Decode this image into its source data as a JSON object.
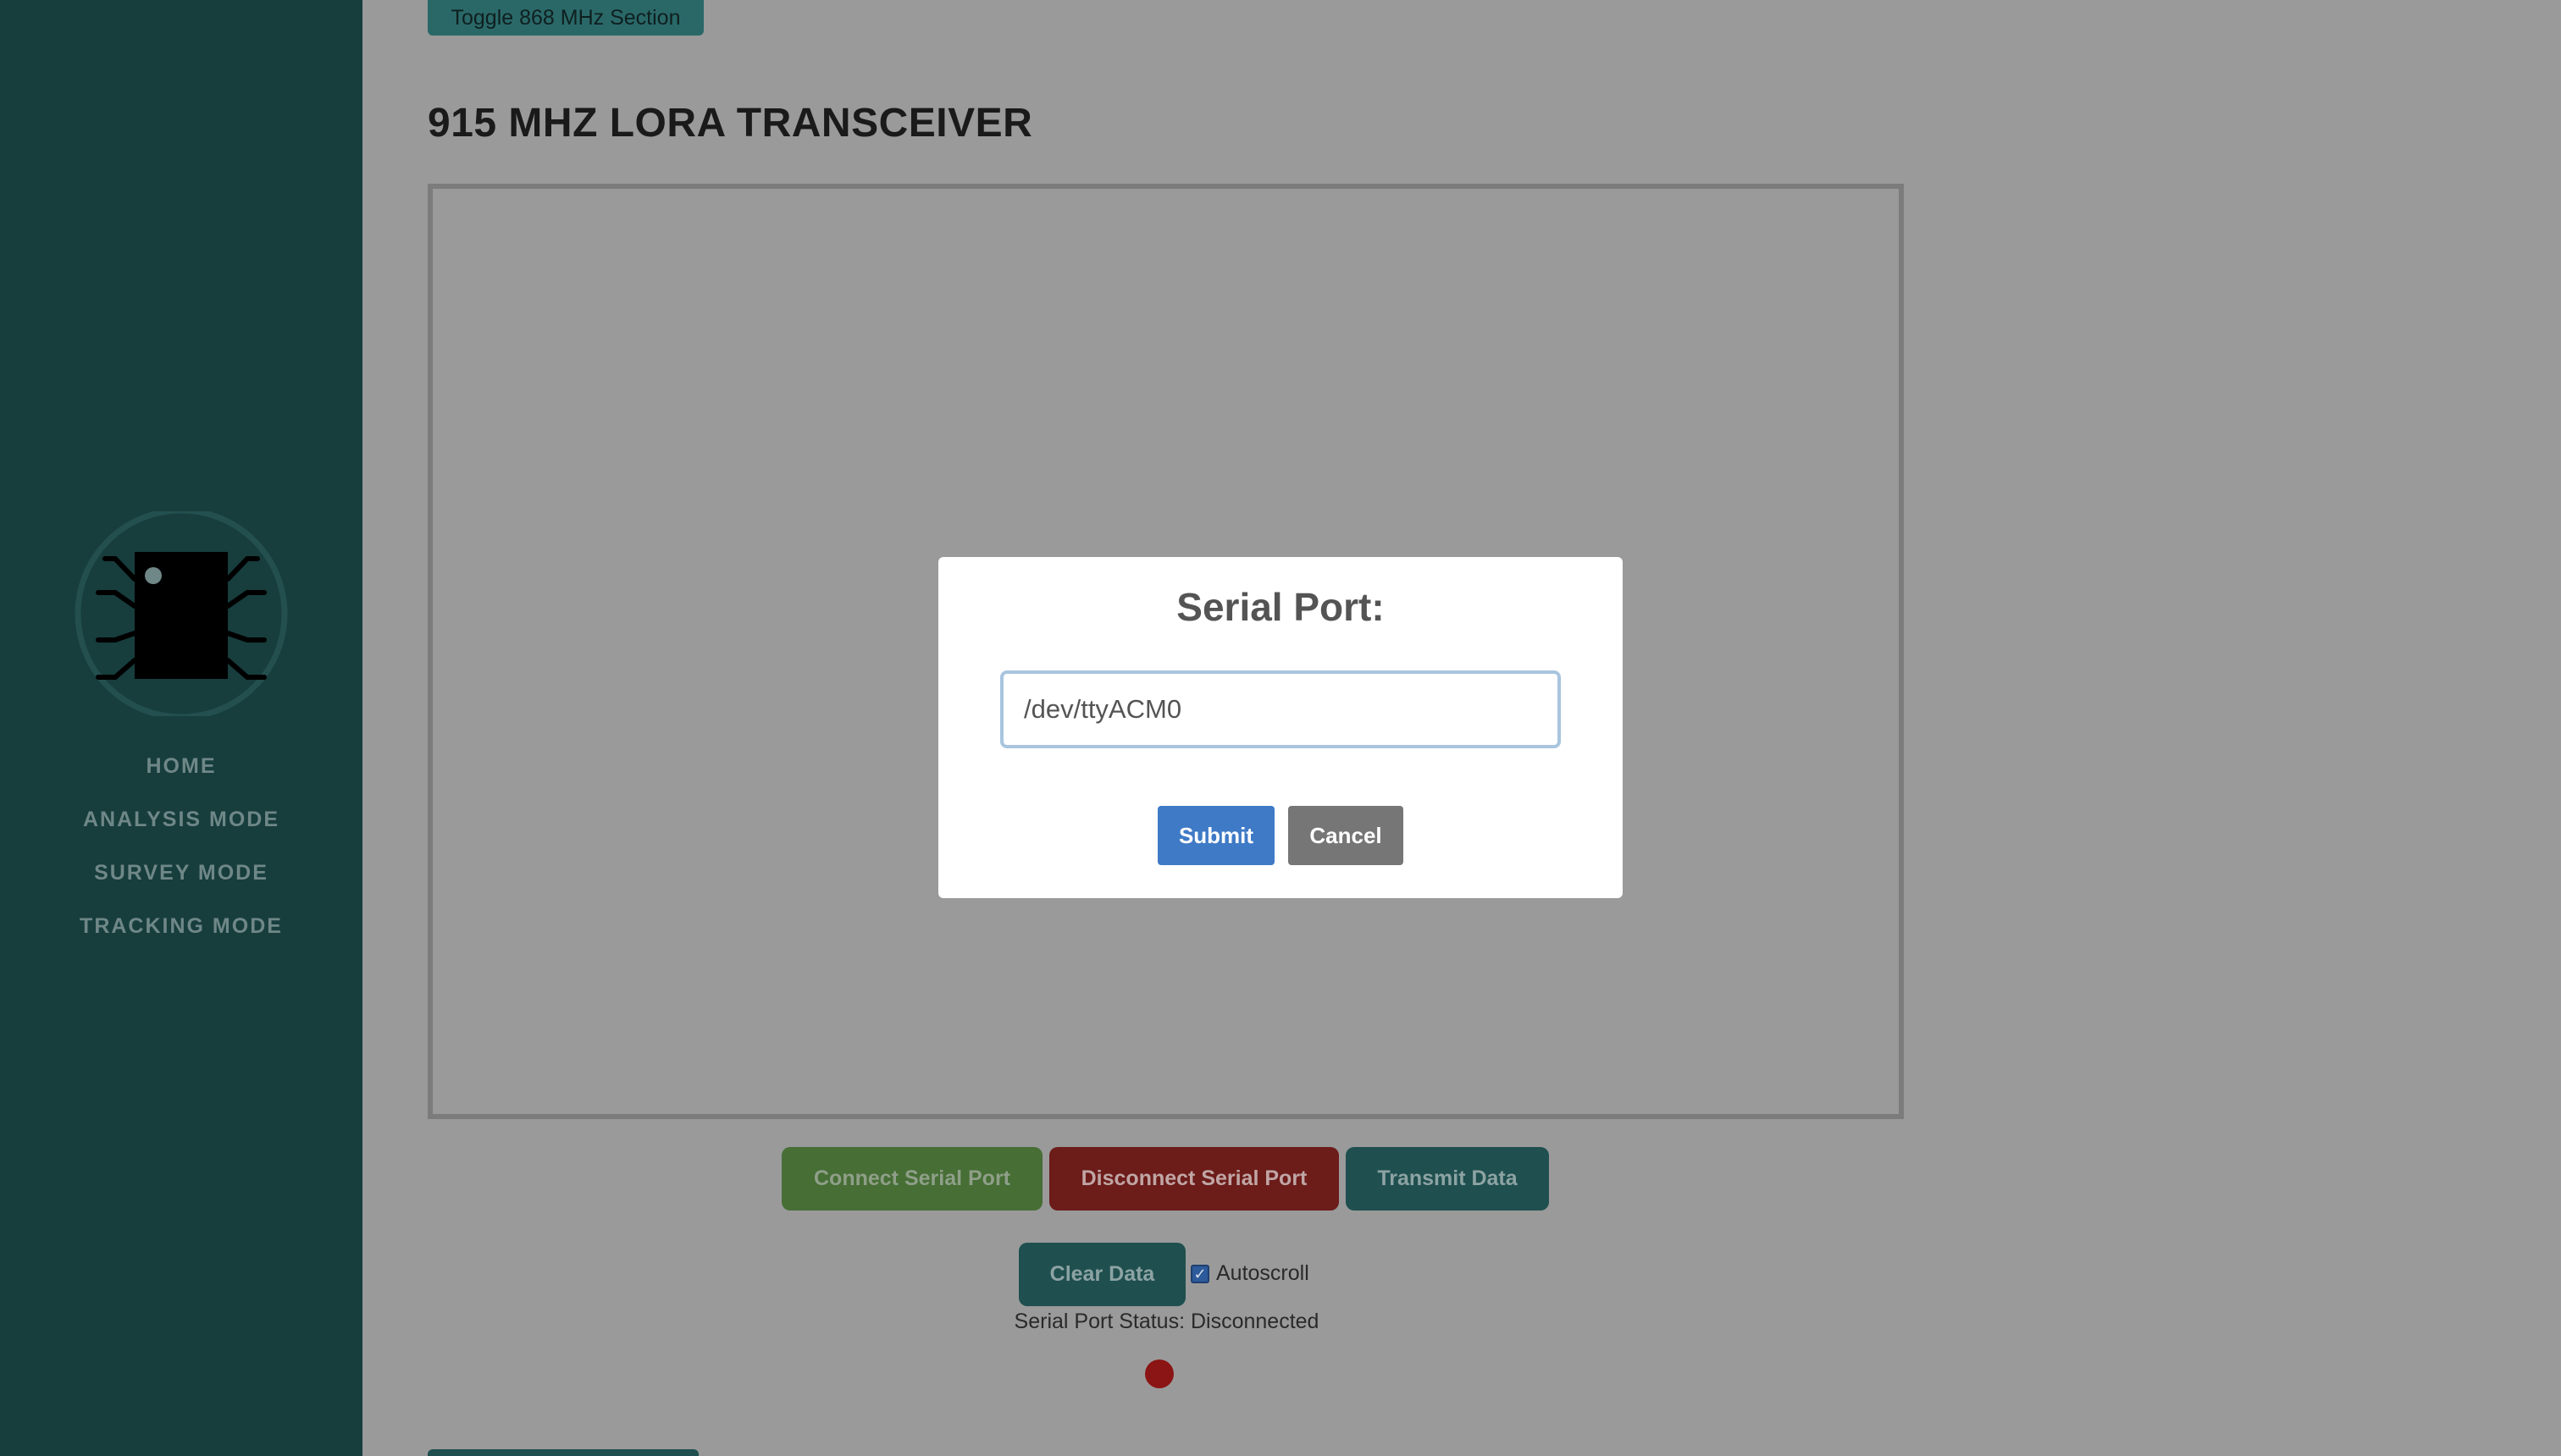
{
  "sidebar": {
    "logo_icon": "chip-bug-icon",
    "nav": [
      "HOME",
      "ANALYSIS MODE",
      "SURVEY MODE",
      "TRACKING MODE"
    ]
  },
  "main": {
    "toggle_label": "Toggle 868 MHz Section",
    "section_title": "915 MHZ LORA TRANSCEIVER",
    "buttons": {
      "connect": "Connect Serial Port",
      "disconnect": "Disconnect Serial Port",
      "transmit": "Transmit Data",
      "clear": "Clear Data"
    },
    "autoscroll_label": "Autoscroll",
    "autoscroll_checked": true,
    "status_text": "Serial Port Status: Disconnected",
    "status_color": "#8b1414"
  },
  "modal": {
    "title": "Serial Port:",
    "input_value": "/dev/ttyACM0",
    "submit_label": "Submit",
    "cancel_label": "Cancel"
  },
  "colors": {
    "sidebar_bg": "#173d3d",
    "overlay_bg": "#9a9a9a",
    "submit_blue": "#3f7ac6"
  }
}
